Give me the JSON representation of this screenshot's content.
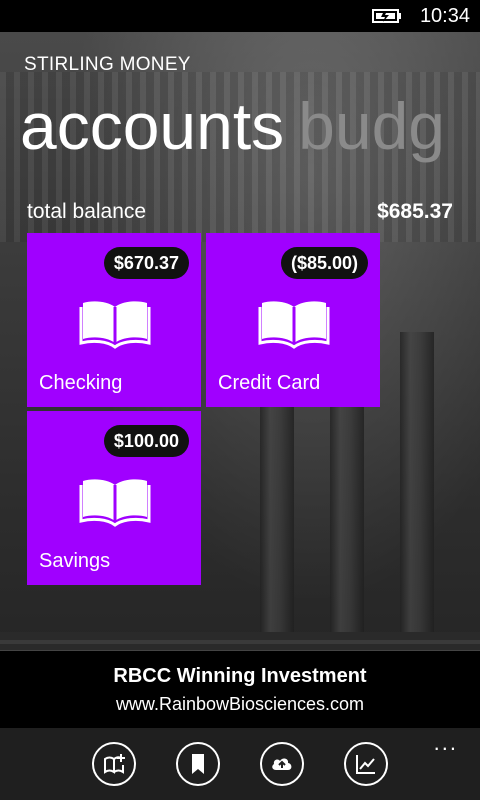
{
  "status_bar": {
    "time": "10:34"
  },
  "app_title": "STIRLING MONEY",
  "pivot": {
    "active": "accounts",
    "next": "budg"
  },
  "total": {
    "label": "total balance",
    "value": "$685.37"
  },
  "accounts": [
    {
      "name": "Checking",
      "balance": "$670.37",
      "icon": "book-icon"
    },
    {
      "name": "Credit Card",
      "balance": "($85.00)",
      "icon": "book-icon"
    },
    {
      "name": "Savings",
      "balance": "$100.00",
      "icon": "book-icon"
    }
  ],
  "ad": {
    "title": "RBCC Winning Investment",
    "url": "www.RainbowBiosciences.com"
  },
  "app_bar": {
    "ellipsis": "...",
    "buttons": [
      {
        "icon": "add-account-icon"
      },
      {
        "icon": "bookmark-icon"
      },
      {
        "icon": "cloud-upload-icon"
      },
      {
        "icon": "chart-icon"
      }
    ]
  },
  "colors": {
    "tile": "#a000ff",
    "background": "#000000",
    "app_bar": "#1f1f1f"
  }
}
